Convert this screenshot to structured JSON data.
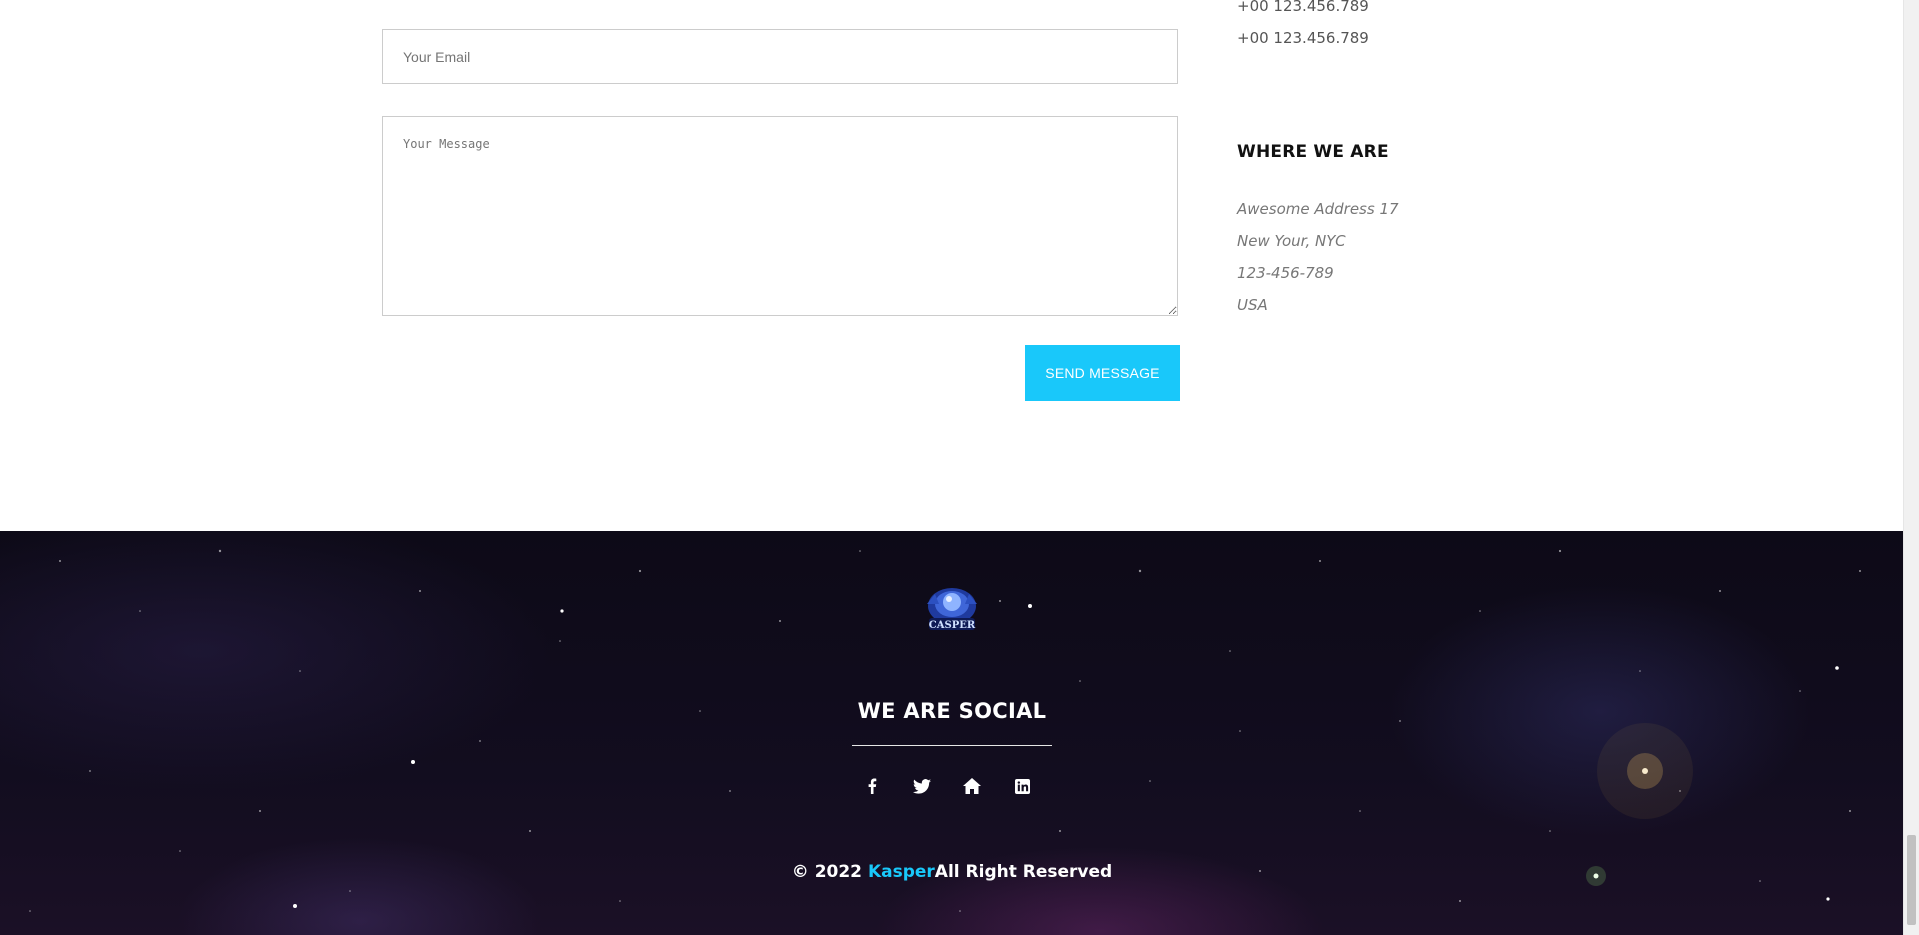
{
  "contact_form": {
    "email_placeholder": "Your Email",
    "email_value": "",
    "message_placeholder": "Your Message",
    "message_value": "",
    "send_label": "SEND MESSAGE"
  },
  "contact_info": {
    "phones": [
      "+00 123.456.789",
      "+00 123.456.789"
    ],
    "where_heading": "WHERE WE ARE",
    "address_lines": [
      "Awesome Address 17",
      "New Your, NYC",
      "123-456-789",
      "USA"
    ]
  },
  "footer": {
    "logo_text": "CASPER",
    "social_title": "WE ARE SOCIAL",
    "social_icons": [
      "facebook-icon",
      "twitter-icon",
      "home-icon",
      "linkedin-icon"
    ],
    "copyright_prefix": "© 2022 ",
    "brand_name": "Kasper",
    "copyright_suffix": "All Right Reserved"
  },
  "colors": {
    "accent": "#19c8fa",
    "footer_bg": "#0d0a17",
    "address_text": "#777777"
  }
}
